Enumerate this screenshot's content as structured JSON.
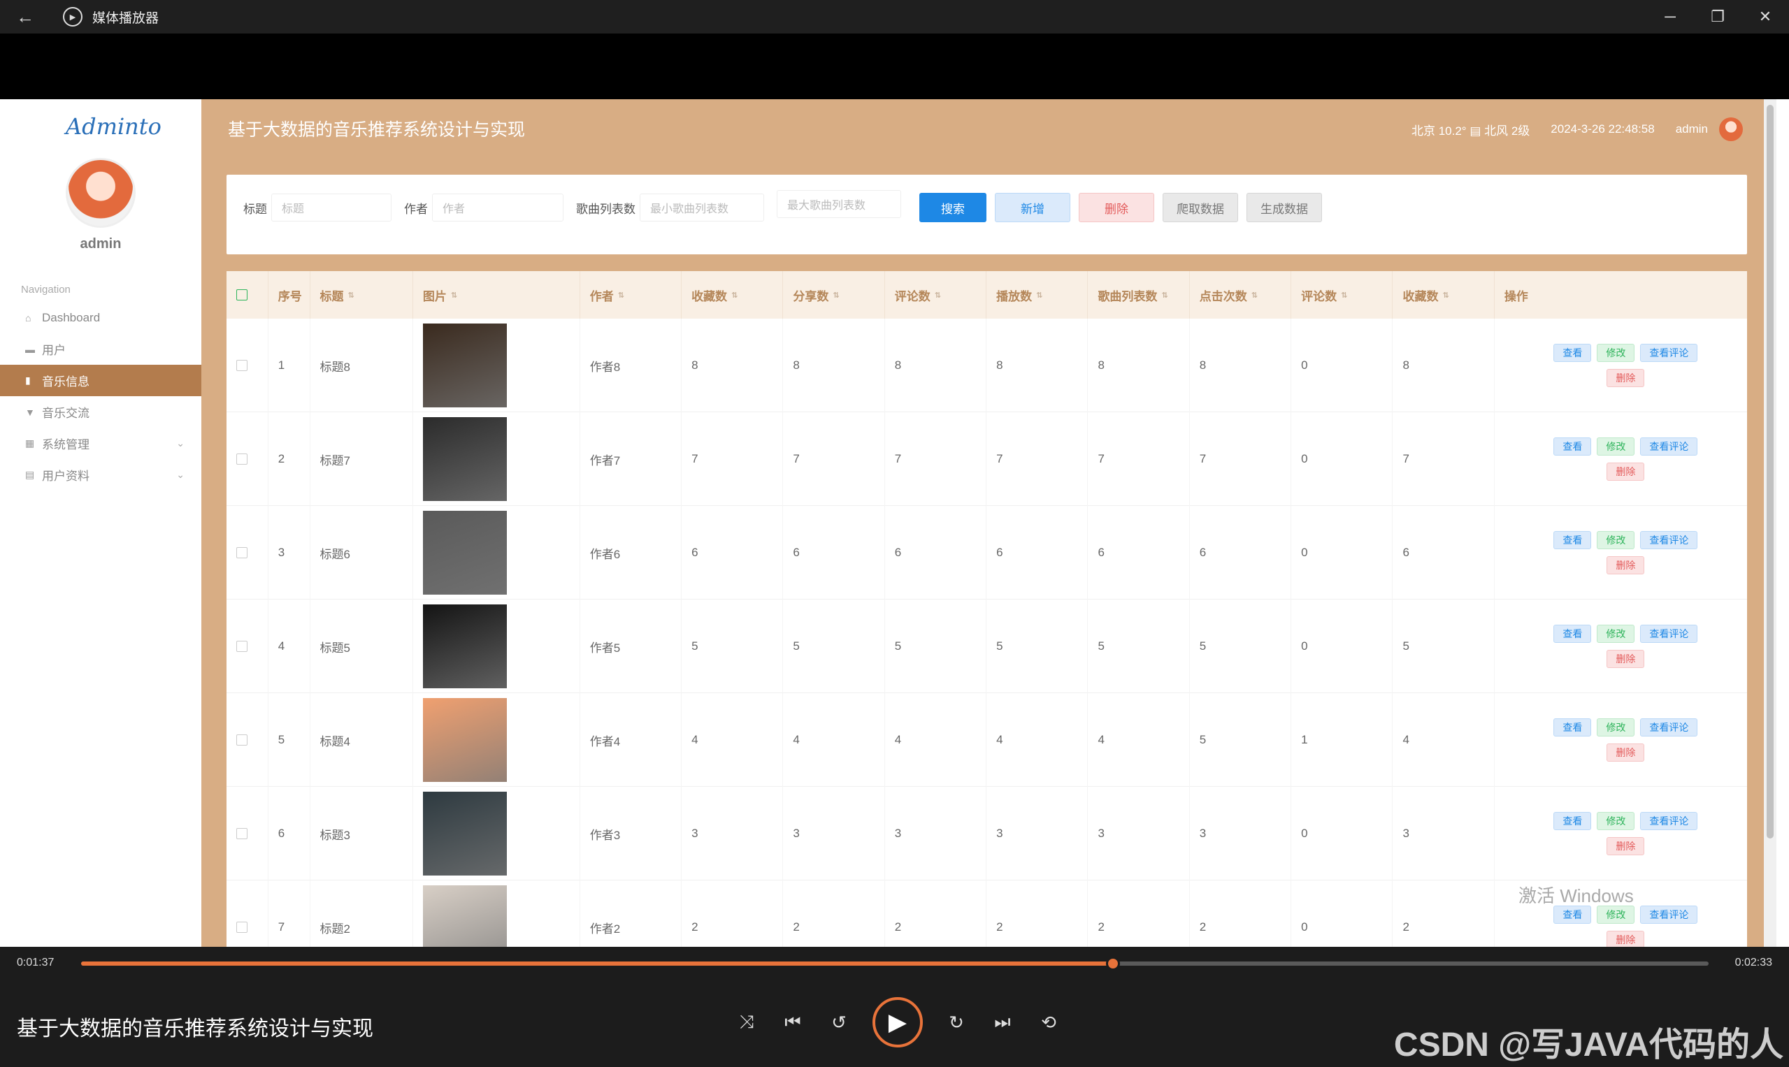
{
  "window": {
    "title": "媒体播放器",
    "back_icon": "←",
    "app_icon": "▶",
    "min_icon": "─",
    "restore_icon": "❐",
    "close_icon": "✕"
  },
  "sidebar": {
    "logo": "Adminto",
    "user": "admin",
    "nav_heading": "Navigation",
    "items": [
      {
        "icon": "⌂",
        "label": "Dashboard"
      },
      {
        "icon": "▬",
        "label": "用户"
      },
      {
        "icon": "▮",
        "label": "音乐信息"
      },
      {
        "icon": "▼",
        "label": "音乐交流"
      },
      {
        "icon": "▦",
        "label": "系统管理",
        "chevron": "⌄"
      },
      {
        "icon": "▤",
        "label": "用户资料",
        "chevron": "⌄"
      }
    ]
  },
  "header": {
    "title": "基于大数据的音乐推荐系统设计与实现",
    "weather": "北京  10.2°  ▤  北风  2级",
    "datetime": "2024-3-26 22:48:58",
    "user": "admin"
  },
  "search": {
    "title_label": "标题",
    "title_placeholder": "标题",
    "author_label": "作者",
    "author_placeholder": "作者",
    "playlist_label": "歌曲列表数",
    "min_placeholder": "最小歌曲列表数",
    "max_placeholder": "最大歌曲列表数",
    "search_btn": "搜索",
    "add_btn": "新增",
    "delete_btn": "删除",
    "crawl_btn": "爬取数据",
    "generate_btn": "生成数据"
  },
  "table": {
    "sort_icon": "⇅",
    "headers": [
      "序号",
      "标题",
      "图片",
      "作者",
      "收藏数",
      "分享数",
      "评论数",
      "播放数",
      "歌曲列表数",
      "点击次数",
      "评论数",
      "收藏数",
      "操作"
    ],
    "ops": {
      "view": "查看",
      "edit": "修改",
      "comments": "查看评论",
      "delete": "删除"
    },
    "rows": [
      {
        "no": "1",
        "title": "标题8",
        "author": "作者8",
        "c1": "8",
        "c2": "8",
        "c3": "8",
        "c4": "8",
        "c5": "8",
        "c6": "8",
        "c7": "0",
        "c8": "8",
        "img": "#3a2a1e"
      },
      {
        "no": "2",
        "title": "标题7",
        "author": "作者7",
        "c1": "7",
        "c2": "7",
        "c3": "7",
        "c4": "7",
        "c5": "7",
        "c6": "7",
        "c7": "0",
        "c8": "7",
        "img": "#2b2b2b"
      },
      {
        "no": "3",
        "title": "标题6",
        "author": "作者6",
        "c1": "6",
        "c2": "6",
        "c3": "6",
        "c4": "6",
        "c5": "6",
        "c6": "6",
        "c7": "0",
        "c8": "6",
        "img": "#5a5a5a"
      },
      {
        "no": "4",
        "title": "标题5",
        "author": "作者5",
        "c1": "5",
        "c2": "5",
        "c3": "5",
        "c4": "5",
        "c5": "5",
        "c6": "5",
        "c7": "0",
        "c8": "5",
        "img": "#141414"
      },
      {
        "no": "5",
        "title": "标题4",
        "author": "作者4",
        "c1": "4",
        "c2": "4",
        "c3": "4",
        "c4": "4",
        "c5": "4",
        "c6": "5",
        "c7": "1",
        "c8": "4",
        "img": "#f0a070"
      },
      {
        "no": "6",
        "title": "标题3",
        "author": "作者3",
        "c1": "3",
        "c2": "3",
        "c3": "3",
        "c4": "3",
        "c5": "3",
        "c6": "3",
        "c7": "0",
        "c8": "3",
        "img": "#2e3a40"
      },
      {
        "no": "7",
        "title": "标题2",
        "author": "作者2",
        "c1": "2",
        "c2": "2",
        "c3": "2",
        "c4": "2",
        "c5": "2",
        "c6": "2",
        "c7": "0",
        "c8": "2",
        "img": "#d8cfc6"
      }
    ]
  },
  "watermark": "激活 Windows",
  "player": {
    "elapsed": "0:01:37",
    "total": "0:02:33",
    "progress": 0.634,
    "media_title": "基于大数据的音乐推荐系统设计与实现",
    "shuffle_icon": "⤨",
    "prev_icon": "⏮",
    "rewind_icon": "↺",
    "play_icon": "▶",
    "forward_icon": "↻",
    "next_icon": "⏭",
    "repeat_icon": "⟲",
    "credit": "CSDN @写JAVA代码的人"
  },
  "colors": {
    "accent": "#d8ad84",
    "active_nav": "#b37c4d",
    "progress": "#e8733a",
    "primary": "#1e88e5"
  }
}
